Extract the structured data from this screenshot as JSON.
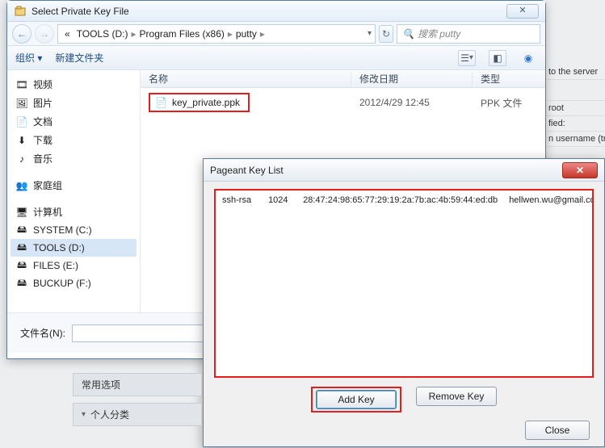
{
  "bg": {
    "l1": "to the server",
    "l2": "root",
    "l3": "fied:",
    "l4": "n username (tran"
  },
  "filedlg": {
    "title": "Select Private Key File",
    "close_glyph": "✕",
    "breadcrumb": {
      "root_icon": "«",
      "seg1": "TOOLS (D:)",
      "seg2": "Program Files (x86)",
      "seg3": "putty",
      "sep": "▸"
    },
    "search_placeholder": "搜索 putty",
    "toolbar": {
      "organize": "组织 ▾",
      "newfolder": "新建文件夹"
    },
    "nav": {
      "video": "视频",
      "pictures": "图片",
      "documents": "文档",
      "downloads": "下载",
      "music": "音乐",
      "homegroup": "家庭组",
      "computer": "计算机",
      "drive_c": "SYSTEM (C:)",
      "drive_d": "TOOLS (D:)",
      "drive_e": "FILES (E:)",
      "drive_f": "BUCKUP (F:)"
    },
    "columns": {
      "name": "名称",
      "date": "修改日期",
      "type": "类型"
    },
    "file": {
      "name": "key_private.ppk",
      "date": "2012/4/29 12:45",
      "type": "PPK 文件"
    },
    "filename_label": "文件名(N):"
  },
  "pageant": {
    "title": "Pageant Key List",
    "key": {
      "algo": "ssh-rsa",
      "bits": "1024",
      "fingerprint": "28:47:24:98:65:77:29:19:2a:7b:ac:4b:59:44:ed:db",
      "comment": "hellwen.wu@gmail.com"
    },
    "add_key": "Add Key",
    "remove_key": "Remove Key",
    "close": "Close"
  },
  "leftover": {
    "common_options": "常用选项",
    "personal_cat": "个人分类"
  }
}
